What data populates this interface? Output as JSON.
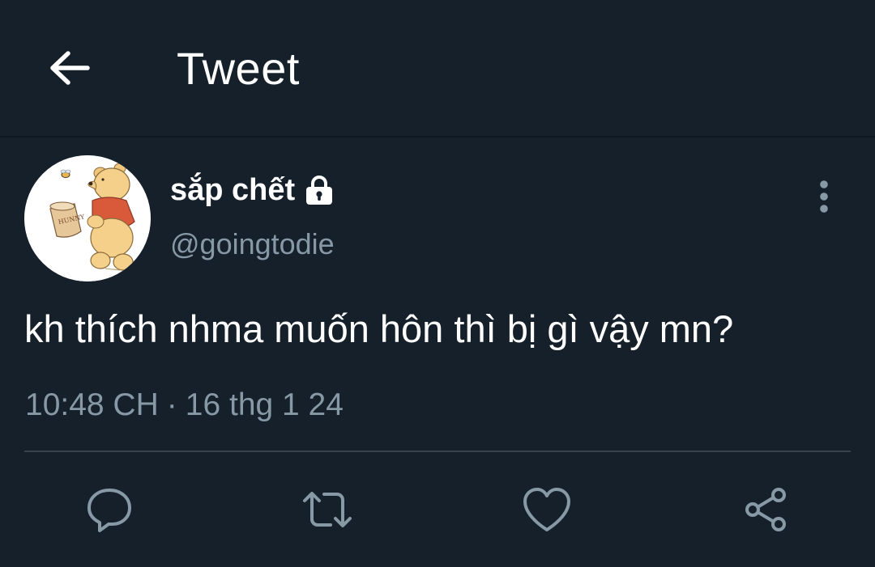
{
  "header": {
    "back_icon": "arrow-left-icon",
    "title": "Tweet"
  },
  "tweet": {
    "author": {
      "display_name": "sắp chết",
      "handle": "@goingtodie",
      "protected_icon": "lock-icon",
      "avatar": "winnie-the-pooh-avatar"
    },
    "text": "kh thích nhma muốn hôn thì bị gì vậy mn?",
    "time": "10:48 CH",
    "separator": "·",
    "date": "16 thg 1 24",
    "more_icon": "more-vertical-icon"
  },
  "actions": [
    {
      "name": "reply",
      "icon": "comment-icon"
    },
    {
      "name": "retweet",
      "icon": "retweet-icon"
    },
    {
      "name": "like",
      "icon": "heart-icon"
    },
    {
      "name": "share",
      "icon": "share-icon"
    }
  ],
  "colors": {
    "background": "#15202b",
    "primary_text": "#ffffff",
    "secondary_text": "#8899a6",
    "divider": "#38444d"
  }
}
